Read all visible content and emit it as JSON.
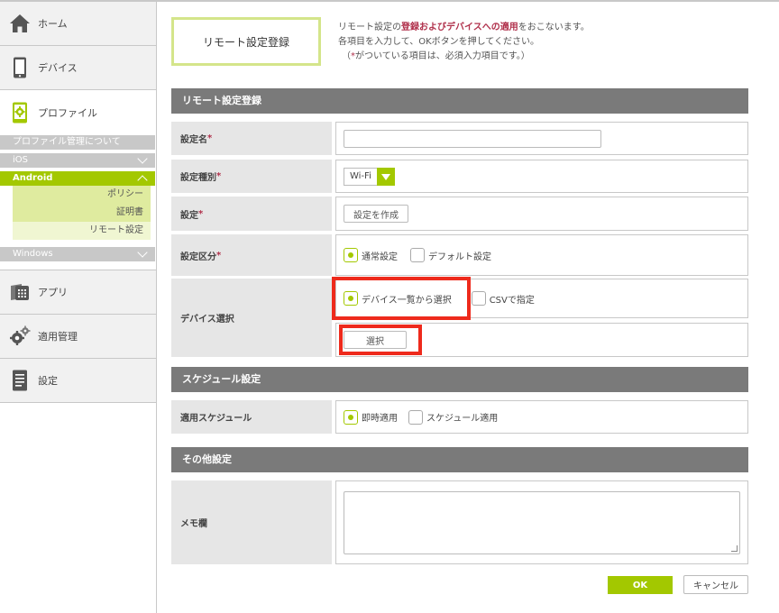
{
  "sidebar": {
    "home_label": "ホーム",
    "device_label": "デバイス",
    "profile_label": "プロファイル",
    "profile_about": "プロファイル管理について",
    "ios_label": "iOS",
    "android_label": "Android",
    "android_items": [
      "ポリシー",
      "証明書",
      "リモート設定"
    ],
    "windows_label": "Windows",
    "app_label": "アプリ",
    "apply_label": "適用管理",
    "settings_label": "設定"
  },
  "header": {
    "title": "リモート設定登録",
    "intro_pre": "リモート設定の",
    "intro_strong": "登録およびデバイスへの適用",
    "intro_post": "をおこないます。",
    "intro_line2": "各項目を入力して、OKボタンを押してください。",
    "intro_line3_pre": "（",
    "intro_line3_ast": "*",
    "intro_line3_post": "がついている項目は、必須入力項目です。）"
  },
  "sections": {
    "remote": "リモート設定登録",
    "schedule": "スケジュール設定",
    "other": "その他設定"
  },
  "form": {
    "name_label": "設定名",
    "type_label": "設定種別",
    "type_value": "Wi-Fi",
    "setting_label": "設定",
    "create_button": "設定を作成",
    "category_label": "設定区分",
    "category_normal": "通常設定",
    "category_default": "デフォルト設定",
    "device_label": "デバイス選択",
    "device_list": "デバイス一覧から選択",
    "device_csv": "CSVで指定",
    "select_button": "選択",
    "schedule_label": "適用スケジュール",
    "schedule_now": "即時適用",
    "schedule_scheduled": "スケジュール適用",
    "memo_label": "メモ欄",
    "required_mark": "*"
  },
  "footer": {
    "ok": "OK",
    "cancel": "キャンセル"
  },
  "colors": {
    "accent": "#a3c800",
    "highlight": "#ee2a1c",
    "section_bg": "#7a7a7a"
  }
}
